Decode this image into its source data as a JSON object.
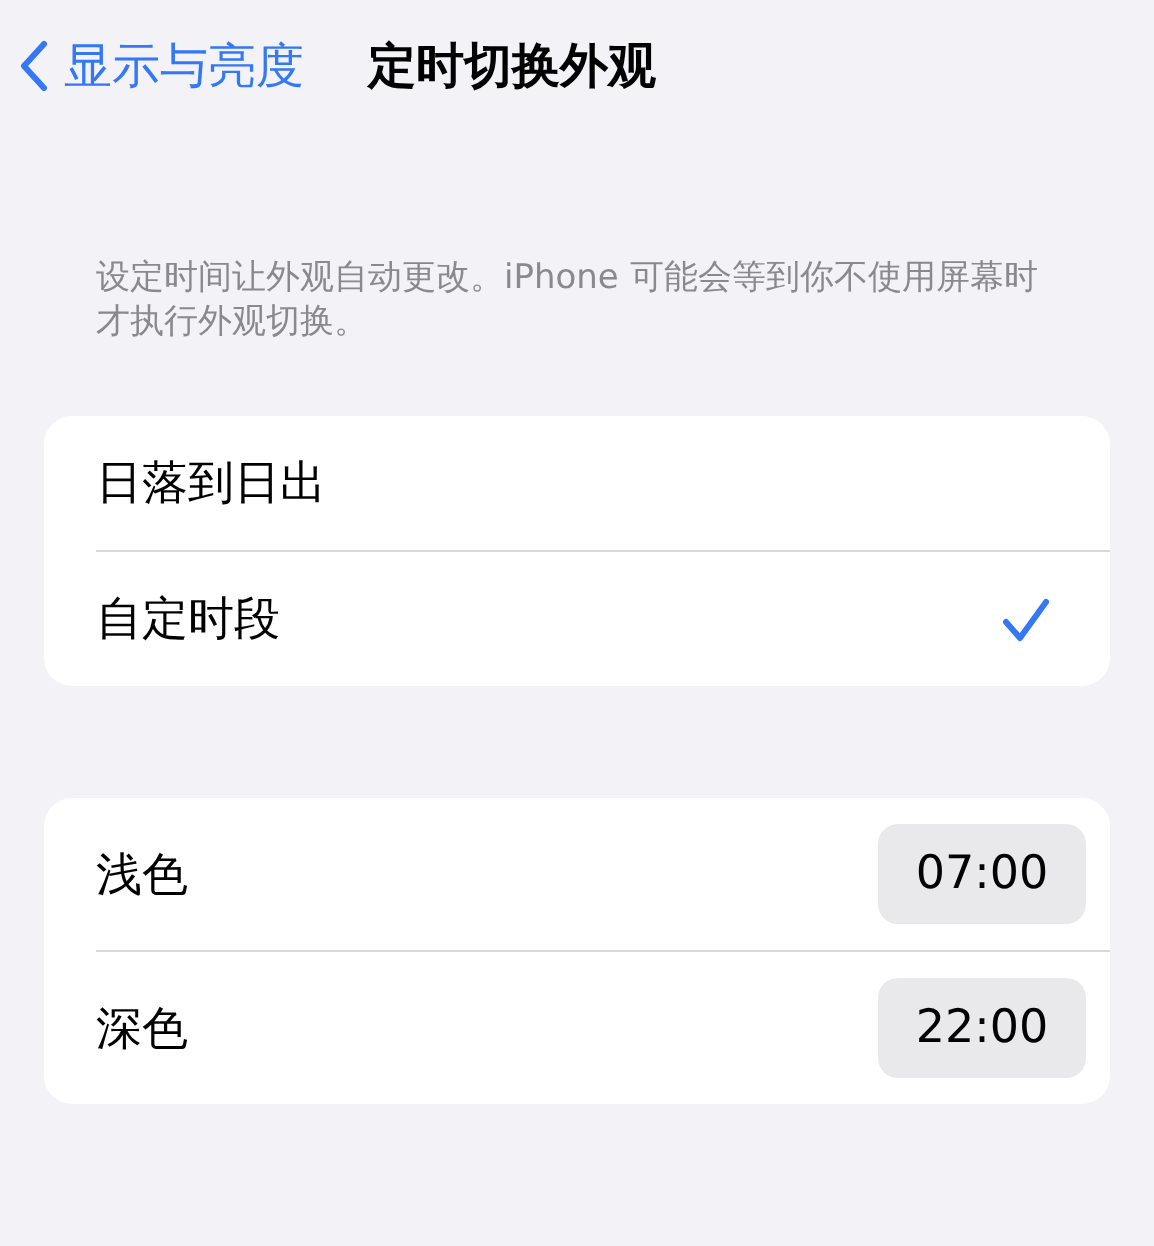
{
  "nav": {
    "back_label": "显示与亮度",
    "title": "定时切换外观"
  },
  "description": "设定时间让外观自动更改。iPhone 可能会等到你不使用屏幕时才执行外观切换。",
  "schedule_options": [
    {
      "label": "日落到日出",
      "selected": false
    },
    {
      "label": "自定时段",
      "selected": true
    }
  ],
  "times": [
    {
      "label": "浅色",
      "value": "07:00"
    },
    {
      "label": "深色",
      "value": "22:00"
    }
  ]
}
